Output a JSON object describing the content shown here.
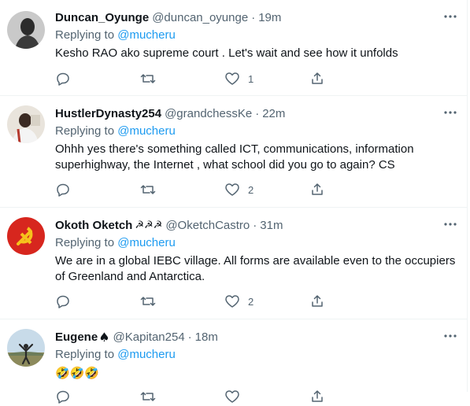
{
  "tweets": [
    {
      "name": "Duncan_Oyunge",
      "name_suffix": "",
      "handle": "@duncan_oyunge",
      "time": "19m",
      "replying_prefix": "Replying to",
      "replying_to": "@mucheru",
      "text": "Kesho RAO ako supreme court . Let's wait and see how it unfolds",
      "replies": "",
      "retweets": "",
      "likes": "1"
    },
    {
      "name": "HustlerDynasty254",
      "name_suffix": "",
      "handle": "@grandchessKe",
      "time": "22m",
      "replying_prefix": "Replying to",
      "replying_to": "@mucheru",
      "text": "Ohhh yes there's something called ICT, communications, information superhighway, the Internet , what school did you go to again? CS",
      "replies": "",
      "retweets": "",
      "likes": "2"
    },
    {
      "name": "Okoth Oketch",
      "name_suffix": "☭☭☭",
      "handle": "@OketchCastro",
      "time": "31m",
      "replying_prefix": "Replying to",
      "replying_to": "@mucheru",
      "text": "We are in a global IEBC village. All forms are available even to the occupiers of Greenland and Antarctica.",
      "replies": "",
      "retweets": "",
      "likes": "2"
    },
    {
      "name": "Eugene",
      "name_suffix": "♠",
      "handle": "@Kapitan254",
      "time": "18m",
      "replying_prefix": "Replying to",
      "replying_to": "@mucheru",
      "text": "🤣🤣🤣",
      "replies": "",
      "retweets": "",
      "likes": ""
    }
  ],
  "separator": "·",
  "colors": {
    "link": "#1d9bf0",
    "secondary": "#536471",
    "text": "#0f1419",
    "divider": "#eff3f4"
  },
  "icons": [
    "more-icon",
    "reply-icon",
    "retweet-icon",
    "like-icon",
    "share-icon"
  ]
}
